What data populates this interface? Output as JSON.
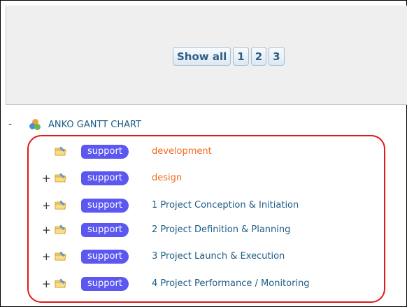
{
  "pager": {
    "show_all": "Show all",
    "pages": [
      "1",
      "2",
      "3"
    ]
  },
  "tree": {
    "root": {
      "toggle": "-",
      "label": "ANKO GANTT CHART",
      "icon": "project-cluster-icon"
    },
    "items": [
      {
        "toggle": "",
        "tag": "support",
        "label": "development",
        "label_color": "orange",
        "icon": "folder-pencil-icon"
      },
      {
        "toggle": "+",
        "tag": "support",
        "label": "design",
        "label_color": "orange",
        "icon": "folder-pencil-icon"
      },
      {
        "toggle": "+",
        "tag": "support",
        "label": "1 Project Conception & Initiation",
        "label_color": "blue",
        "icon": "folder-pencil-icon"
      },
      {
        "toggle": "+",
        "tag": "support",
        "label": "2 Project Definition & Planning",
        "label_color": "blue",
        "icon": "folder-pencil-icon"
      },
      {
        "toggle": "+",
        "tag": "support",
        "label": "3 Project Launch & Execution",
        "label_color": "blue",
        "icon": "folder-pencil-icon"
      },
      {
        "toggle": "+",
        "tag": "support",
        "label": "4 Project Performance / Monitoring",
        "label_color": "blue",
        "icon": "folder-pencil-icon"
      }
    ]
  },
  "colors": {
    "tag_bg": "#5b57f0",
    "orange_text": "#f26b1d",
    "blue_text": "#1e5d86",
    "highlight": "#e01a1a"
  }
}
